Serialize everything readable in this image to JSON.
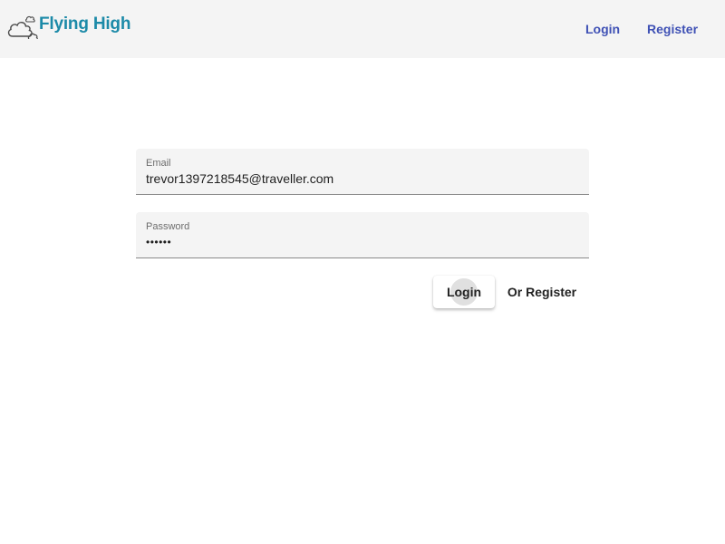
{
  "header": {
    "brand": "Flying High",
    "logo_icon": "cloud-logo-icon",
    "nav": {
      "login_label": "Login",
      "register_label": "Register"
    },
    "colors": {
      "brand": "#1c8aa8",
      "nav_link": "#3f51b5"
    }
  },
  "form": {
    "email": {
      "label": "Email",
      "value": "trevor1397218545@traveller.com"
    },
    "password": {
      "label": "Password",
      "value": "••••••"
    },
    "login_button": "Login",
    "register_button": "Or Register"
  }
}
